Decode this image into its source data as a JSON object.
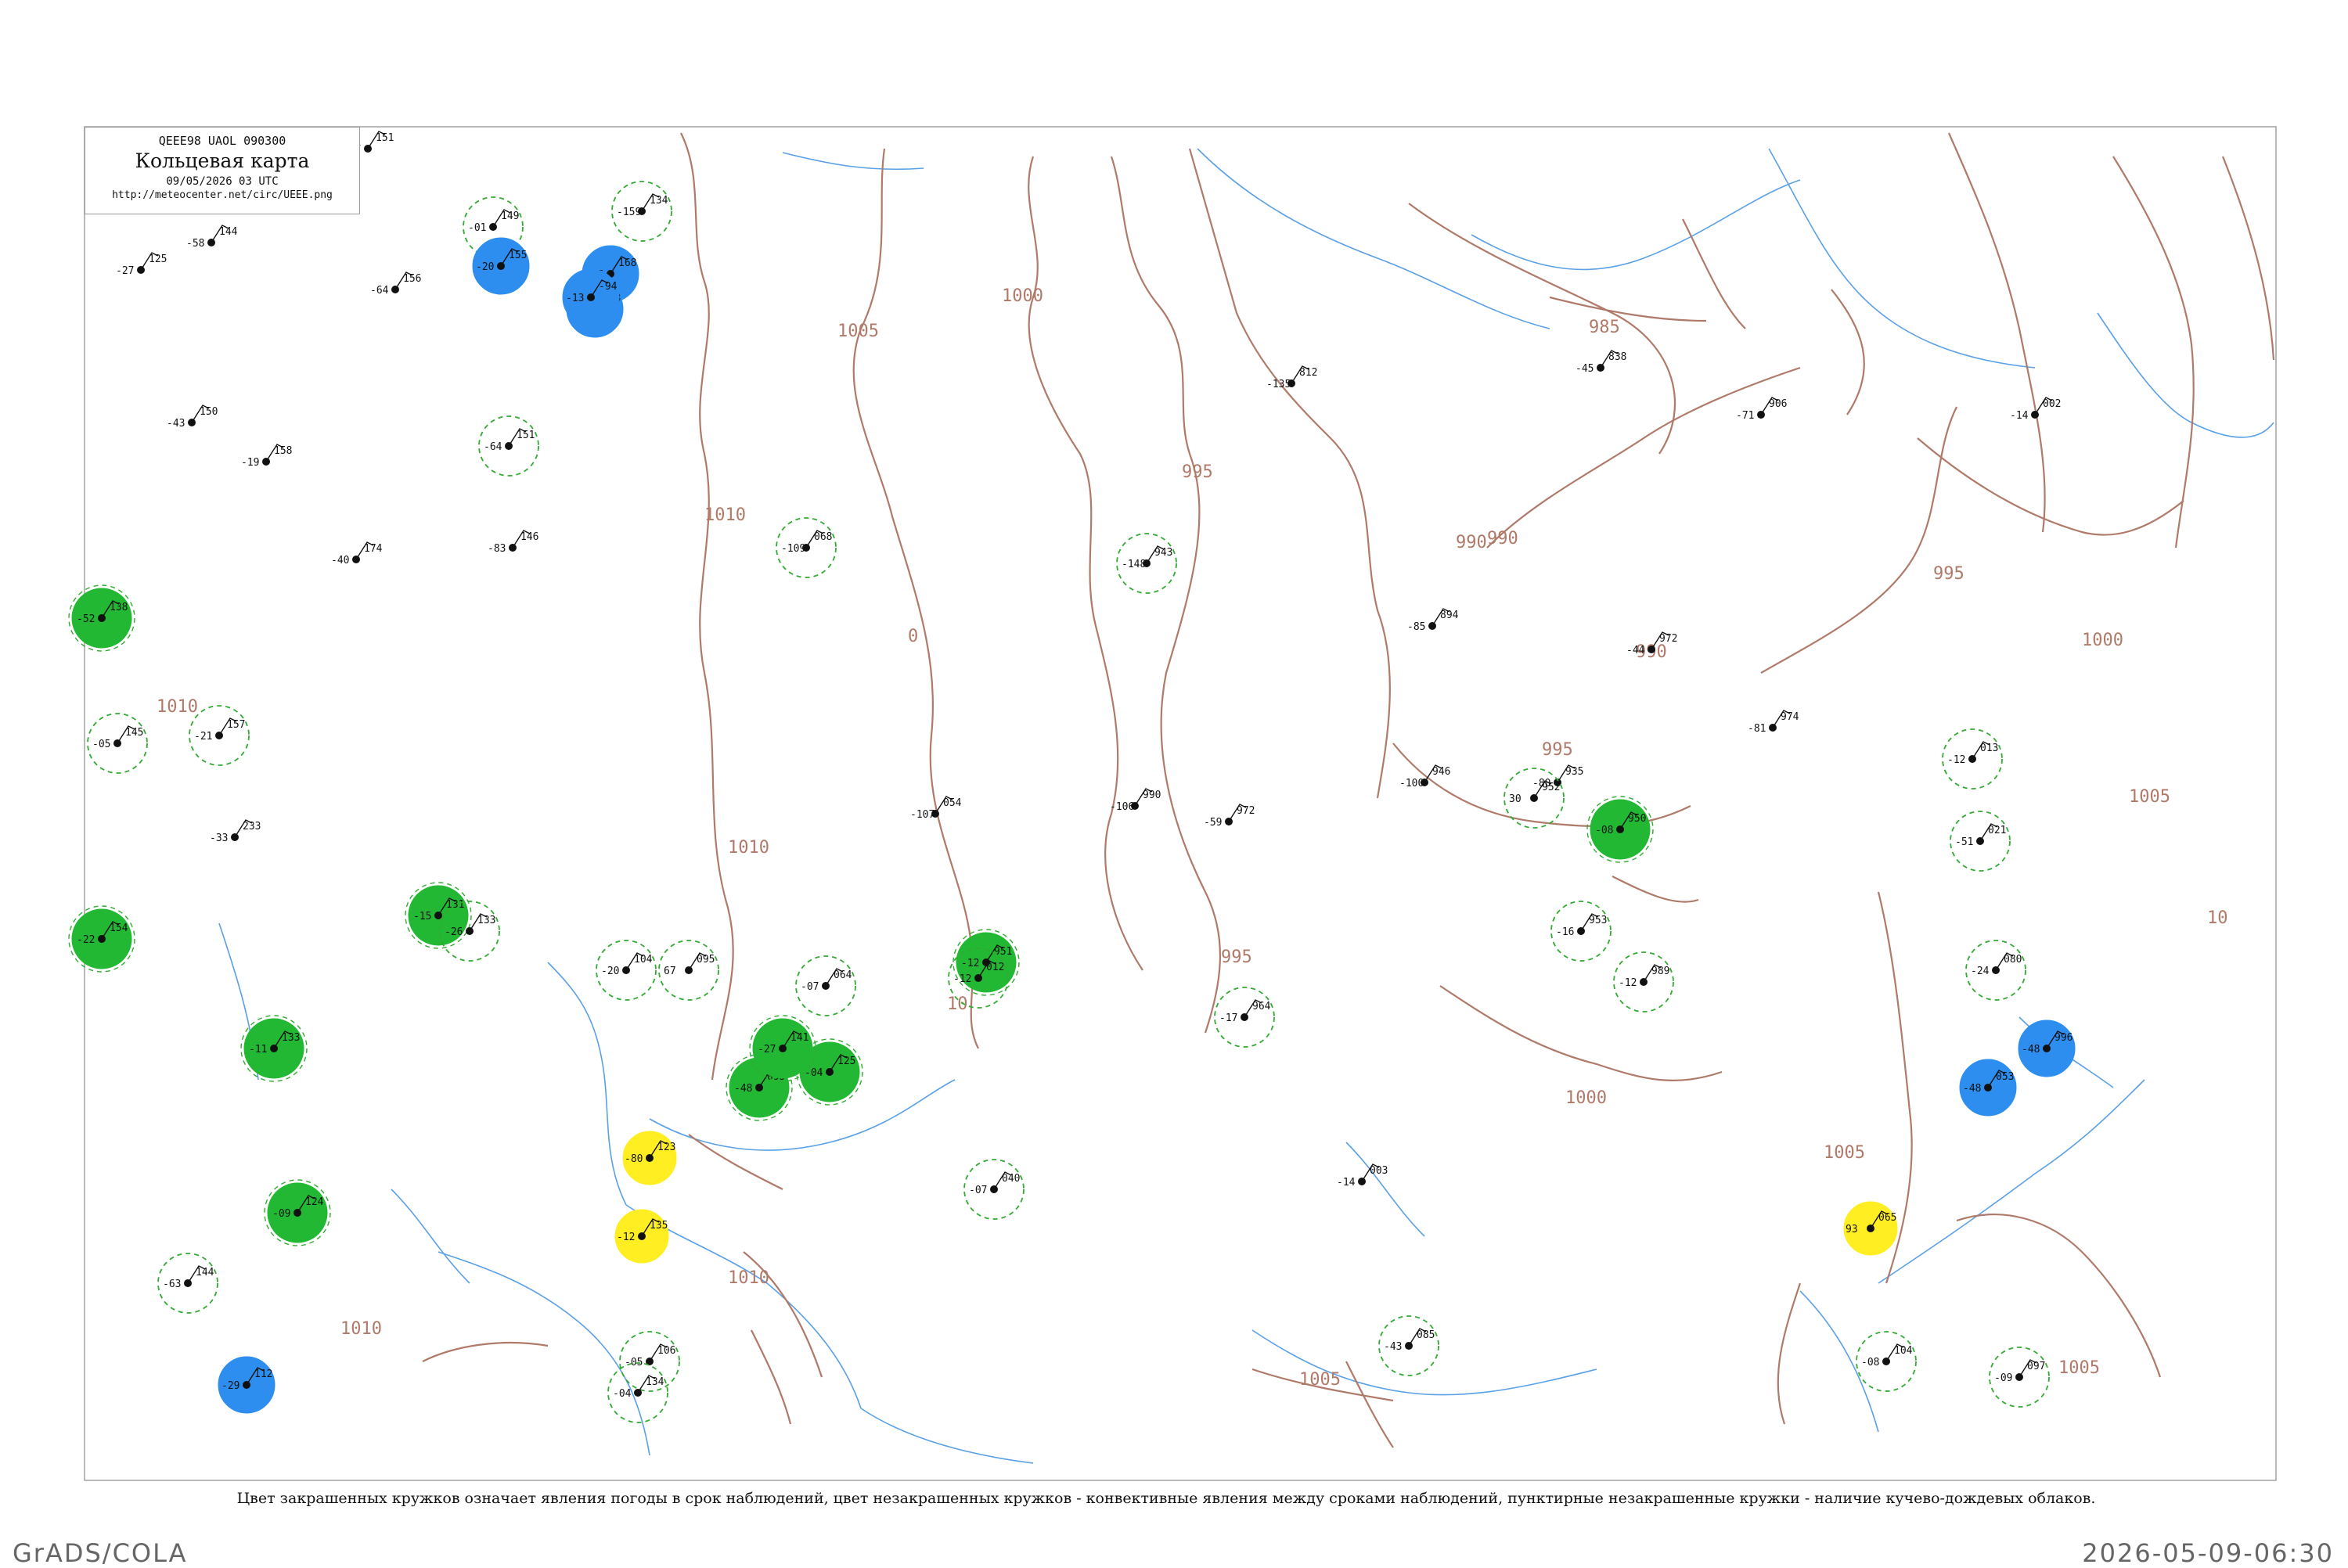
{
  "legend": {
    "code": "QEEE98  UAOL  090300",
    "title": "Кольцевая карта",
    "date": "09/05/2026 03 UTC",
    "url": "http://meteocenter.net/circ/UEEE.png"
  },
  "caption": "Цвет закрашенных кружков означает явления погоды в срок наблюдений, цвет незакрашенных кружков - конвективные явления между сроками наблюдений, пунктирные незакрашенные кружки - наличие кучево-дождевых облаков.",
  "footer": {
    "left": "GrADS/COLA",
    "right": "2026-05-09-06:30"
  },
  "colors": {
    "isobar": "#b07a6a",
    "river": "#5aa0e6",
    "rain": "#22b833",
    "snow": "#2d8ef0",
    "fog": "#ffee22",
    "cb": "#33aa33",
    "frame": "#a0a0a0"
  },
  "isobars": [
    {
      "label": "1005"
    },
    {
      "label": "1000"
    },
    {
      "label": "995"
    },
    {
      "label": "990"
    },
    {
      "label": "985"
    },
    {
      "label": "1010"
    },
    {
      "label": "0"
    },
    {
      "label": "10"
    }
  ],
  "stations": [
    {
      "t": "151",
      "p": "-27",
      "kind": "none"
    },
    {
      "t": "149",
      "p": "-01",
      "kind": "cb"
    },
    {
      "t": "134",
      "p": "-159",
      "kind": "cb"
    },
    {
      "t": "168",
      "p": "-05",
      "kind": "snow"
    },
    {
      "t": "143",
      "p": "13",
      "kind": "snow"
    },
    {
      "t": "-94",
      "p": "-13",
      "kind": "snow"
    },
    {
      "t": "125",
      "p": "-27",
      "kind": "none"
    },
    {
      "t": "144",
      "p": "-58",
      "kind": "none"
    },
    {
      "t": "156",
      "p": "-64",
      "kind": "none"
    },
    {
      "t": "155",
      "p": "-20",
      "kind": "snow"
    },
    {
      "t": "150",
      "p": "-43",
      "kind": "none"
    },
    {
      "t": "151",
      "p": "-64",
      "kind": "cb"
    },
    {
      "t": "158",
      "p": "-19",
      "kind": "none"
    },
    {
      "t": "174",
      "p": "-40",
      "kind": "none"
    },
    {
      "t": "146",
      "p": "-83",
      "kind": "none"
    },
    {
      "t": "068",
      "p": "-109",
      "kind": "cb"
    },
    {
      "t": "943",
      "p": "-148",
      "kind": "cb"
    },
    {
      "t": "812",
      "p": "-135",
      "kind": "none"
    },
    {
      "t": "838",
      "p": "-45",
      "kind": "none"
    },
    {
      "t": "906",
      "p": "-71",
      "kind": "none"
    },
    {
      "t": "002",
      "p": "-14",
      "kind": "none"
    },
    {
      "t": "894",
      "p": "-85",
      "kind": "none"
    },
    {
      "t": "972",
      "p": "-44",
      "kind": "none"
    },
    {
      "t": "974",
      "p": "-81",
      "kind": "none"
    },
    {
      "t": "950",
      "p": "-08",
      "kind": "rain"
    },
    {
      "t": "138",
      "p": "-52",
      "kind": "rain"
    },
    {
      "t": "145",
      "p": "-05",
      "kind": "cb"
    },
    {
      "t": "157",
      "p": "-21",
      "kind": "cb"
    },
    {
      "t": "233",
      "p": "-33",
      "kind": "none"
    },
    {
      "t": "054",
      "p": "-107",
      "kind": "none"
    },
    {
      "t": "990",
      "p": "-106",
      "kind": "none"
    },
    {
      "t": "972",
      "p": "-59",
      "kind": "none"
    },
    {
      "t": "946",
      "p": "-100",
      "kind": "none"
    },
    {
      "t": "935",
      "p": "-80",
      "kind": "none"
    },
    {
      "t": "952",
      "p": "30",
      "kind": "cb"
    },
    {
      "t": "013",
      "p": "-12",
      "kind": "cb"
    },
    {
      "t": "021",
      "p": "-51",
      "kind": "cb"
    },
    {
      "t": "131",
      "p": "-15",
      "kind": "rain"
    },
    {
      "t": "133",
      "p": "-26",
      "kind": "cb"
    },
    {
      "t": "104",
      "p": "-20",
      "kind": "cb"
    },
    {
      "t": "095",
      "p": "67",
      "kind": "cb"
    },
    {
      "t": "064",
      "p": "-07",
      "kind": "cb"
    },
    {
      "t": "125",
      "p": "-04",
      "kind": "rain"
    },
    {
      "t": "095",
      "p": "-48",
      "kind": "rain"
    },
    {
      "t": "951",
      "p": "-12",
      "kind": "rain"
    },
    {
      "t": "964",
      "p": "-17",
      "kind": "cb"
    },
    {
      "t": "953",
      "p": "-16",
      "kind": "cb"
    },
    {
      "t": "989",
      "p": "-12",
      "kind": "cb"
    },
    {
      "t": "080",
      "p": "-24",
      "kind": "cb"
    },
    {
      "t": "996",
      "p": "-48",
      "kind": "snow"
    },
    {
      "t": "053",
      "p": "-48",
      "kind": "snow"
    },
    {
      "t": "123",
      "p": "-80",
      "kind": "fog"
    },
    {
      "t": "135",
      "p": "-12",
      "kind": "fog"
    },
    {
      "t": "065",
      "p": "93",
      "kind": "fog"
    },
    {
      "t": "154",
      "p": "-22",
      "kind": "rain"
    },
    {
      "t": "133",
      "p": "-11",
      "kind": "rain"
    },
    {
      "t": "141",
      "p": "-27",
      "kind": "rain"
    },
    {
      "t": "106",
      "p": "-05",
      "kind": "cb"
    },
    {
      "t": "112",
      "p": "-29",
      "kind": "snow"
    },
    {
      "t": "134",
      "p": "-04",
      "kind": "cb"
    },
    {
      "t": "144",
      "p": "-63",
      "kind": "cb"
    },
    {
      "t": "124",
      "p": "-09",
      "kind": "rain"
    },
    {
      "t": "012",
      "p": "-12",
      "kind": "cb"
    },
    {
      "t": "040",
      "p": "-07",
      "kind": "cb"
    },
    {
      "t": "085",
      "p": "-43",
      "kind": "cb"
    },
    {
      "t": "003",
      "p": "-14",
      "kind": "none"
    },
    {
      "t": "104",
      "p": "-08",
      "kind": "cb"
    },
    {
      "t": "097",
      "p": "-09",
      "kind": "cb"
    }
  ]
}
